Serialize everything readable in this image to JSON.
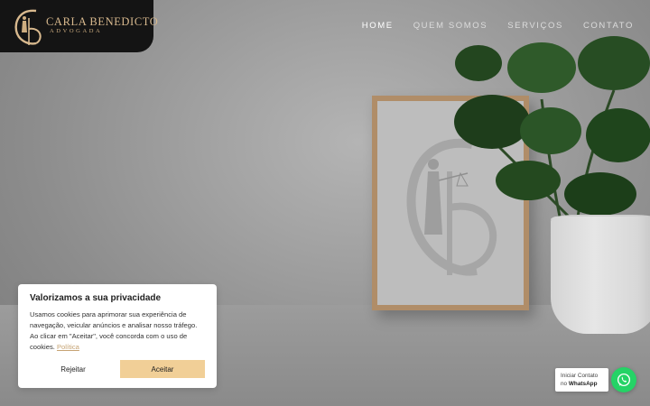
{
  "brand": {
    "name": "CARLA BENEDICTO",
    "subtitle": "ADVOGADA",
    "logo_icon": "cb-monogram-logo",
    "accent_color": "#d8b98e"
  },
  "nav": {
    "items": [
      {
        "label": "HOME",
        "active": true
      },
      {
        "label": "QUEM SOMOS",
        "active": false
      },
      {
        "label": "SERVIÇOS",
        "active": false
      },
      {
        "label": "CONTATO",
        "active": false
      }
    ]
  },
  "cookie": {
    "title": "Valorizamos a sua privacidade",
    "text": "Usamos cookies para aprimorar sua experiência de navegação, veicular anúncios e analisar nosso tráfego. Ao clicar em \"Aceitar\", você concorda com o uso de cookies.",
    "policy_link": "Política",
    "reject_label": "Rejeitar",
    "accept_label": "Aceitar",
    "accept_color": "#f1cf97"
  },
  "whatsapp": {
    "line1": "Iniciar Contato",
    "line2_prefix": "no",
    "line2_brand": "WhatsApp",
    "icon": "whatsapp-icon",
    "color": "#25d366"
  }
}
